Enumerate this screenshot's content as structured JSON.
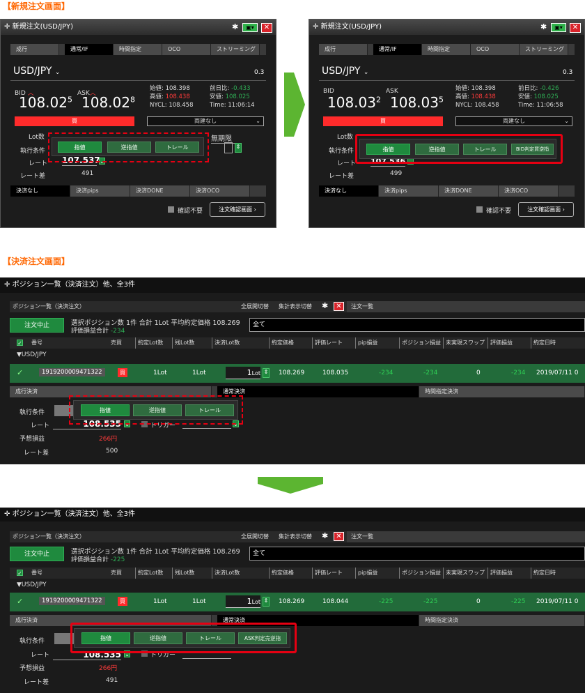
{
  "sections": {
    "new_order_title": "【新規注文画面】",
    "close_order_title": "【決済注文画面】"
  },
  "new_order": {
    "title": "新規注文(USD/JPY)",
    "tabs": [
      "成行",
      "通常/IF",
      "時間指定",
      "OCO",
      "ストリーミング"
    ],
    "pair": "USD/JPY",
    "spread": "0.3",
    "bid_label": "BID",
    "ask_label": "ASK",
    "stats_labels": {
      "open": "始値:",
      "high": "高値:",
      "nycl": "NYCL:",
      "prev": "前日比:",
      "low": "安値:",
      "time": "Time:"
    },
    "stats": {
      "open": "108.398",
      "high": "108.438",
      "nycl": "108.458",
      "low": "108.025"
    },
    "sell_label": "買",
    "both_label": "両建なし",
    "lot_label": "Lot数",
    "exec_label": "執行条件",
    "rate_label": "レート",
    "rate_diff_label": "レート差",
    "expiry_label": "無期限",
    "order_types": [
      "指値",
      "逆指値",
      "トレール"
    ],
    "settle_tabs": [
      "決済なし",
      "決済pips",
      "決済DONE",
      "決済OCO"
    ],
    "confirm_label": "確認不要",
    "confirm_btn": "注文確認画面",
    "before": {
      "bid_main": "108.02",
      "bid_sup": "5",
      "ask_main": "108.02",
      "ask_sup": "8",
      "prev_change": "-0.433",
      "time": "11:06:14",
      "rate": "107.537",
      "rate_diff": "491",
      "lot_partial": "1Lot"
    },
    "after": {
      "bid_main": "108.03",
      "bid_sup": "2",
      "ask_main": "108.03",
      "ask_sup": "5",
      "prev_change": "-0.426",
      "time": "11:06:58",
      "rate": "107.536",
      "rate_diff": "499",
      "extra_btn": "BID判定買逆指"
    }
  },
  "close_order": {
    "title": "ポジション一覧（決済注文）他、全3件",
    "panel_title": "ポジション一覧（決済注文）",
    "expand_label": "全展開切替",
    "summary_toggle": "集計表示切替",
    "order_list_tab": "注文一覧",
    "cancel_btn": "注文中止",
    "summary_line": "選択ポジション数 1件  合計 1Lot 平均約定価格 108.269",
    "eval_label": "評価損益合計",
    "filter_value": "全て",
    "columns": [
      "番号",
      "売買",
      "約定Lot数",
      "残Lot数",
      "決済Lot数",
      "約定価格",
      "評価レート",
      "pip損益",
      "ポジション損益",
      "未実現スワップ",
      "評価損益",
      "約定日時"
    ],
    "group_label": "▼USD/JPY",
    "row": {
      "id": "1919200009471322",
      "side": "買",
      "lot": "1Lot",
      "remain": "1Lot",
      "close_lot": "1",
      "close_unit": "Lot",
      "price": "108.269",
      "swap": "0",
      "date": "2019/07/11 0"
    },
    "tabs": [
      "成行決済",
      "通常決済",
      "時間指定決済"
    ],
    "exec_label": "執行条件",
    "rate_label": "レート",
    "pl_label": "予想損益",
    "rate_diff_label": "レート差",
    "order_types": [
      "指値",
      "逆指値",
      "トレール"
    ],
    "trigger_label": "トリガー",
    "before": {
      "eval": "-234",
      "eval_rate": "108.035",
      "pip": "-234",
      "pos_pl": "-234",
      "eval_pl": "-234",
      "rate": "108.535",
      "pl": "266円",
      "rate_diff": "500"
    },
    "after": {
      "eval": "-225",
      "eval_rate": "108.044",
      "pip": "-225",
      "pos_pl": "-225",
      "eval_pl": "-225",
      "rate": "108.535",
      "pl": "266円",
      "rate_diff": "491",
      "extra_btn": "ASK判定売逆指"
    }
  },
  "colors": {
    "accent_red": "#e60012",
    "arrow_green": "#5cb531",
    "button_green": "#1f8a3e"
  }
}
